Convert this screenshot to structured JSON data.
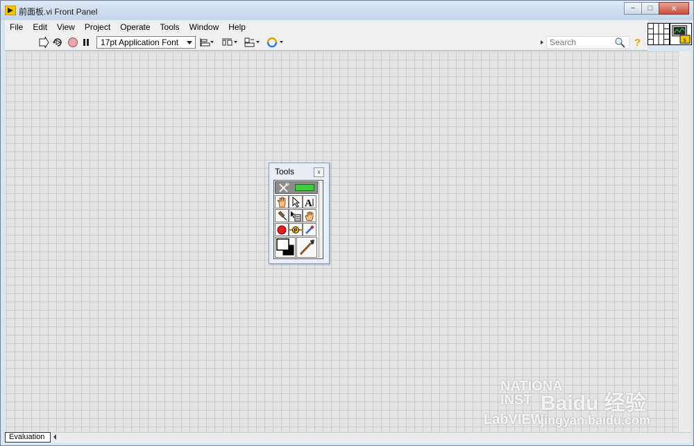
{
  "window": {
    "title": "前面板.vi Front Panel",
    "minimize_label": "−",
    "maximize_label": "□",
    "close_label": "✕"
  },
  "menu": [
    {
      "label": "File"
    },
    {
      "label": "Edit"
    },
    {
      "label": "View"
    },
    {
      "label": "Project"
    },
    {
      "label": "Operate"
    },
    {
      "label": "Tools"
    },
    {
      "label": "Window"
    },
    {
      "label": "Help"
    }
  ],
  "toolbar": {
    "run_icon": "run-arrow-icon",
    "run_continuously_icon": "run-continuously-icon",
    "abort_icon": "abort-icon",
    "pause_icon": "pause-icon",
    "font_value": "17pt Application Font",
    "align_icon": "align-objects-icon",
    "distribute_icon": "distribute-objects-icon",
    "resize_icon": "resize-objects-icon",
    "reorder_icon": "reorder-icon",
    "search_placeholder": "Search",
    "help_label": "?"
  },
  "tools_palette": {
    "title": "Tools",
    "close_label": "x",
    "tools": [
      "automatic-tool-selection",
      "operate-value",
      "position-size-select",
      "edit-text",
      "connect-wire",
      "object-shortcut-menu",
      "scroll-window",
      "set-clear-breakpoint",
      "probe-data",
      "get-color",
      "set-color"
    ]
  },
  "status": {
    "evaluation_label": "Evaluation"
  },
  "watermark": {
    "line1": "NATIONA",
    "line2": "INST",
    "line3": "Baidu 经验",
    "line4": "LabVIEW",
    "line5": "jingyan.baidu.com"
  },
  "colors": {
    "canvas": "#e4e4e4",
    "grid": "#cdcdcd",
    "titlebar": "#c4d5ea"
  }
}
